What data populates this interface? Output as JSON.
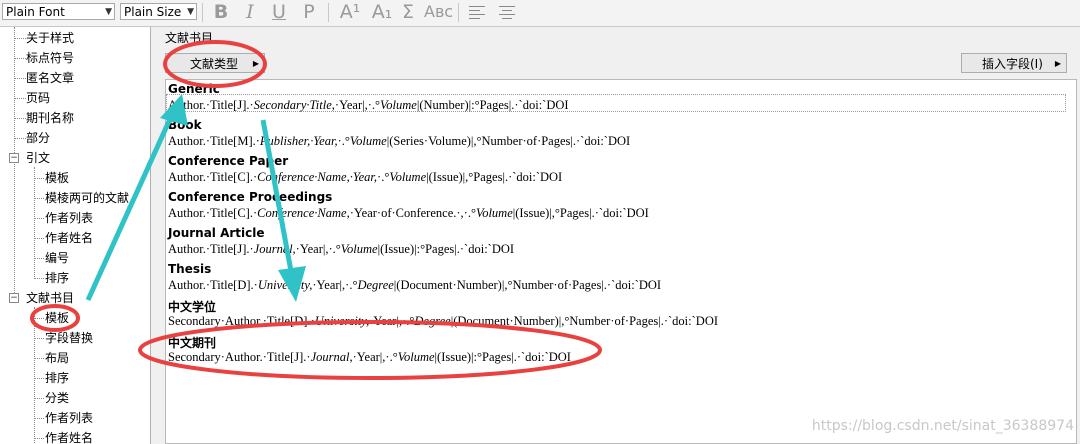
{
  "toolbar": {
    "font_value": "Plain Font",
    "size_value": "Plain Size",
    "bold": "B",
    "italic": "I",
    "underline": "U",
    "plain": "P",
    "superscript": "A¹",
    "subscript": "A₁",
    "symbol": "Σ",
    "smallcaps": "Aʙᴄ"
  },
  "tree": {
    "items": [
      {
        "label": "关于样式"
      },
      {
        "label": "标点符号"
      },
      {
        "label": "匿名文章"
      },
      {
        "label": "页码"
      },
      {
        "label": "期刊名称"
      },
      {
        "label": "部分"
      },
      {
        "label": "引文"
      },
      {
        "label": "模板"
      },
      {
        "label": "模棱两可的文献"
      },
      {
        "label": "作者列表"
      },
      {
        "label": "作者姓名"
      },
      {
        "label": "编号"
      },
      {
        "label": "排序"
      },
      {
        "label": "文献书目"
      },
      {
        "label": "模板"
      },
      {
        "label": "字段替换"
      },
      {
        "label": "布局"
      },
      {
        "label": "排序"
      },
      {
        "label": "分类"
      },
      {
        "label": "作者列表"
      },
      {
        "label": "作者姓名"
      }
    ]
  },
  "panel": {
    "title": "文献书目",
    "ref_type_button": "文献类型",
    "insert_field_button": "插入字段(I)"
  },
  "references": [
    {
      "type": "Generic",
      "segments": [
        [
          "Author.·Title[J].·",
          false
        ],
        [
          "Secondary·Title,",
          true
        ],
        [
          "·Year|,·.°",
          false
        ],
        [
          "Volume",
          true
        ],
        [
          "|(Number)|:°Pages|.·`doi:`DOI",
          false
        ]
      ]
    },
    {
      "type": "Book",
      "segments": [
        [
          "Author.·Title[M].·",
          false
        ],
        [
          "Publisher,·Year,",
          true
        ],
        [
          "·.°",
          false
        ],
        [
          "Volume",
          true
        ],
        [
          "|(Series·Volume)|,°Number·of·Pages|.·`doi:`DOI",
          false
        ]
      ]
    },
    {
      "type": "Conference Paper",
      "segments": [
        [
          "Author.·Title[C].·",
          false
        ],
        [
          "Conference·Name,·Year,",
          true
        ],
        [
          "·.°",
          false
        ],
        [
          "Volume",
          true
        ],
        [
          "|(Issue)|,°Pages|.·`doi:`DOI",
          false
        ]
      ]
    },
    {
      "type": "Conference Proceedings",
      "segments": [
        [
          "Author.·Title[C].·",
          false
        ],
        [
          "Conference·Name,",
          true
        ],
        [
          "·Year·of·Conference.·,·.°",
          false
        ],
        [
          "Volume",
          true
        ],
        [
          "|(Issue)|,°Pages|.·`doi:`DOI",
          false
        ]
      ]
    },
    {
      "type": "Journal Article",
      "segments": [
        [
          "Author.·Title[J].·",
          false
        ],
        [
          "Journal,",
          true
        ],
        [
          "·Year|,·.°",
          false
        ],
        [
          "Volume",
          true
        ],
        [
          "|(Issue)|:°Pages|.·`doi:`DOI",
          false
        ]
      ]
    },
    {
      "type": "Thesis",
      "segments": [
        [
          "Author.·Title[D].·",
          false
        ],
        [
          "University,",
          true
        ],
        [
          "·Year|,·.°",
          false
        ],
        [
          "Degree",
          true
        ],
        [
          "|(Document·Number)|,°Number·of·Pages|.·`doi:`DOI",
          false
        ]
      ]
    },
    {
      "type": "中文学位",
      "segments": [
        [
          "Secondary·Author.·Title[D].·",
          false
        ],
        [
          "University,",
          true
        ],
        [
          "·Year|,·.°",
          false
        ],
        [
          "Degree",
          true
        ],
        [
          "|(Document·Number)|,°Number·of·Pages|.·`doi:`DOI",
          false
        ]
      ]
    },
    {
      "type": "中文期刊",
      "segments": [
        [
          "Secondary·Author.·Title[J].·",
          false
        ],
        [
          "Journal,",
          true
        ],
        [
          "·Year|,·.°",
          false
        ],
        [
          "Volume",
          true
        ],
        [
          "|(Issue)|:°Pages|.·`doi:`DOI",
          false
        ]
      ]
    }
  ],
  "watermark": "https://blog.csdn.net/sinat_36388974",
  "annotation_colors": {
    "circle": "#e8413f",
    "arrow": "#2fc3c8"
  }
}
